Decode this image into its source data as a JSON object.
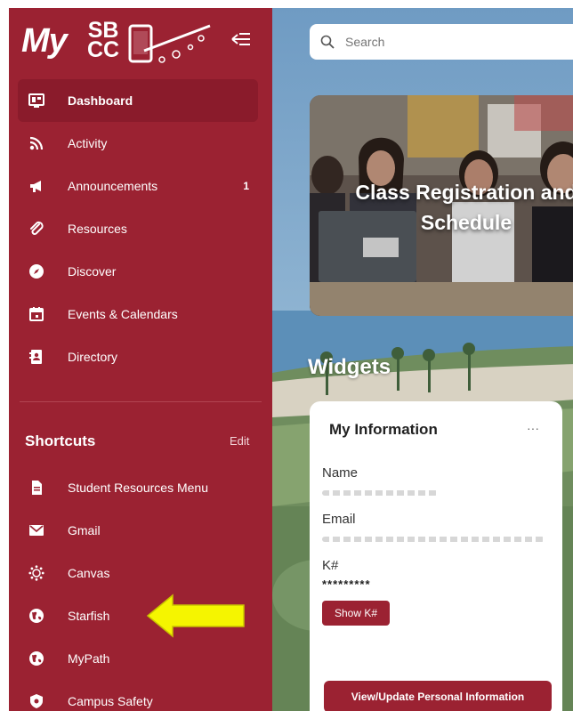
{
  "logo": {
    "my": "My",
    "sbcc_line1": "SB",
    "sbcc_line2": "CC"
  },
  "nav": {
    "items": [
      {
        "label": "Dashboard",
        "icon": "dashboard-icon",
        "active": true
      },
      {
        "label": "Activity",
        "icon": "rss-icon"
      },
      {
        "label": "Announcements",
        "icon": "megaphone-icon",
        "badge": "1"
      },
      {
        "label": "Resources",
        "icon": "paperclip-icon"
      },
      {
        "label": "Discover",
        "icon": "compass-icon"
      },
      {
        "label": "Events & Calendars",
        "icon": "calendar-icon"
      },
      {
        "label": "Directory",
        "icon": "address-book-icon"
      }
    ]
  },
  "shortcuts": {
    "title": "Shortcuts",
    "edit_label": "Edit",
    "items": [
      {
        "label": "Student Resources Menu",
        "icon": "document-icon"
      },
      {
        "label": "Gmail",
        "icon": "mail-icon"
      },
      {
        "label": "Canvas",
        "icon": "canvas-icon"
      },
      {
        "label": "Starfish",
        "icon": "globe-icon"
      },
      {
        "label": "MyPath",
        "icon": "globe-icon"
      },
      {
        "label": "Campus Safety",
        "icon": "shield-icon"
      }
    ]
  },
  "search": {
    "placeholder": "Search"
  },
  "banner": {
    "line1": "Class Registration and",
    "line2": "Schedule"
  },
  "widgets": {
    "title": "Widgets",
    "card": {
      "title": "My Information",
      "menu": "···",
      "name_label": "Name",
      "email_label": "Email",
      "k_label": "K#",
      "k_value": "*********",
      "show_k_label": "Show K#",
      "view_update_label": "View/Update Personal Information"
    }
  },
  "colors": {
    "sidebar": "#9b2232",
    "accent": "#9b2232",
    "arrow": "#f5f500"
  }
}
